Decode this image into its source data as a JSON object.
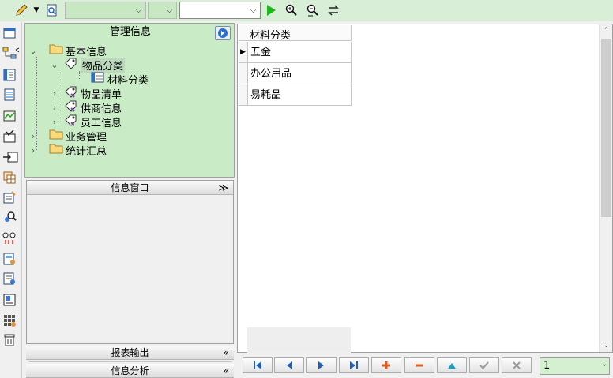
{
  "toolbar": {
    "combo1_value": "",
    "combo2_value": "",
    "combo3_value": ""
  },
  "mgmt": {
    "title": "管理信息",
    "tree": [
      {
        "label": "基本信息"
      },
      {
        "label": "物品分类"
      },
      {
        "label": "材料分类"
      },
      {
        "label": "物品清单"
      },
      {
        "label": "供商信息"
      },
      {
        "label": "员工信息"
      },
      {
        "label": "业务管理"
      },
      {
        "label": "统计汇总"
      }
    ]
  },
  "info_window": {
    "title": "信息窗口",
    "chevron": "≫"
  },
  "report_output": {
    "title": "报表输出",
    "chevron": "«"
  },
  "info_analysis": {
    "title": "信息分析",
    "chevron": "«"
  },
  "grid": {
    "column_header": "材料分类",
    "rows": [
      {
        "value": "五金"
      },
      {
        "value": "办公用品"
      },
      {
        "value": "易耗品"
      }
    ]
  },
  "navigator": {
    "page_value": "1"
  },
  "colors": {
    "toolbar_bg": "#d9eed6",
    "panel_green": "#c9ecc6",
    "accent_green": "#1bb81b",
    "add_red": "#e05a1f"
  }
}
